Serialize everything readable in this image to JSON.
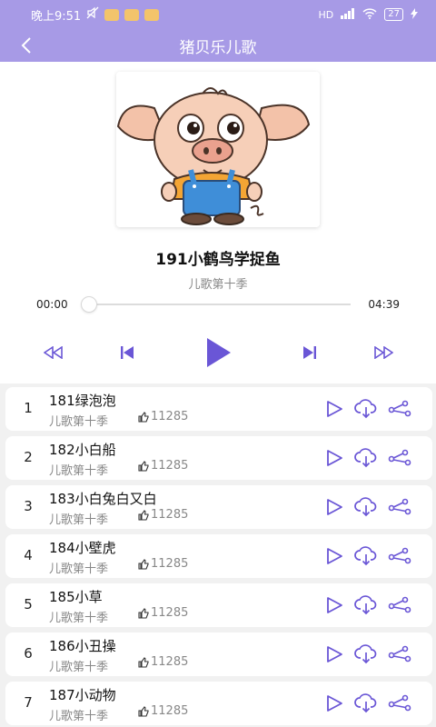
{
  "status": {
    "time": "晚上9:51",
    "network": "HD",
    "battery": "27"
  },
  "nav": {
    "title": "猪贝乐儿歌"
  },
  "player": {
    "song_title": "191小鹤鸟学捉鱼",
    "album": "儿歌第十季",
    "current_time": "00:00",
    "total_time": "04:39",
    "progress": 0
  },
  "playlist": [
    {
      "index": "1",
      "title": "181绿泡泡",
      "album": "儿歌第十季",
      "likes": "11285"
    },
    {
      "index": "2",
      "title": "182小白船",
      "album": "儿歌第十季",
      "likes": "11285"
    },
    {
      "index": "3",
      "title": "183小白兔白又白",
      "album": "儿歌第十季",
      "likes": "11285"
    },
    {
      "index": "4",
      "title": "184小壁虎",
      "album": "儿歌第十季",
      "likes": "11285"
    },
    {
      "index": "5",
      "title": "185小草",
      "album": "儿歌第十季",
      "likes": "11285"
    },
    {
      "index": "6",
      "title": "186小丑操",
      "album": "儿歌第十季",
      "likes": "11285"
    },
    {
      "index": "7",
      "title": "187小动物",
      "album": "儿歌第十季",
      "likes": "11285"
    }
  ],
  "colors": {
    "accent": "#6a56d6",
    "header": "#a79ae6"
  },
  "icons": {
    "back": "chevron-left-icon",
    "rewind": "rewind-icon",
    "prev": "skip-previous-icon",
    "play": "play-icon",
    "next": "skip-next-icon",
    "forward": "fast-forward-icon",
    "row_play": "play-outline-icon",
    "row_download": "cloud-download-icon",
    "row_share": "share-icon",
    "likes": "thumb-up-icon"
  }
}
